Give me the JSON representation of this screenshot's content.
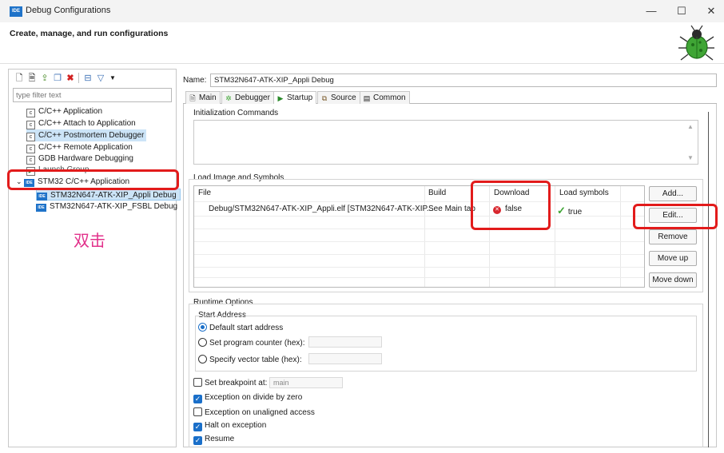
{
  "window": {
    "title": "Debug Configurations",
    "app_badge": "IDE",
    "minimize": "—",
    "maximize": "☐",
    "close": "✕"
  },
  "header": {
    "title": "Create, manage, and run configurations"
  },
  "left": {
    "toolbar_icons": [
      "new-config-icon",
      "new-prototype-icon",
      "export-icon",
      "duplicate-icon",
      "delete-icon",
      "collapse-all-icon",
      "filter-icon",
      "view-menu-icon"
    ],
    "filter_placeholder": "type filter text",
    "tree": [
      {
        "label": "C/C++ Application",
        "icon": "c-icon"
      },
      {
        "label": "C/C++ Attach to Application",
        "icon": "c-icon"
      },
      {
        "label": "C/C++ Postmortem Debugger",
        "icon": "c-icon"
      },
      {
        "label": "C/C++ Remote Application",
        "icon": "c-icon"
      },
      {
        "label": "GDB Hardware Debugging",
        "icon": "c-icon"
      },
      {
        "label": "Launch Group",
        "icon": "launch-group-icon"
      },
      {
        "label": "STM32 C/C++ Application",
        "icon": "ide-icon",
        "expanded": true
      },
      {
        "label": "STM32N647-ATK-XIP_Appli Debug",
        "icon": "ide-icon",
        "selected": true
      },
      {
        "label": "STM32N647-ATK-XIP_FSBL Debug",
        "icon": "ide-icon"
      }
    ],
    "annotation": "双击"
  },
  "main": {
    "name_label": "Name:",
    "name_value": "STM32N647-ATK-XIP_Appli Debug",
    "tabs": [
      {
        "label": "Main",
        "icon": "main-tab-icon"
      },
      {
        "label": "Debugger",
        "icon": "debugger-icon"
      },
      {
        "label": "Startup",
        "icon": "startup-icon",
        "active": true
      },
      {
        "label": "Source",
        "icon": "source-icon"
      },
      {
        "label": "Common",
        "icon": "common-icon"
      }
    ],
    "init_commands": {
      "title": "Initialization Commands",
      "value": ""
    },
    "load_image": {
      "title": "Load Image and Symbols",
      "columns": [
        "File",
        "Build",
        "Download",
        "Load symbols"
      ],
      "rows": [
        {
          "file": "Debug/STM32N647-ATK-XIP_Appli.elf [STM32N647-ATK-XIP...",
          "build": "See Main tab",
          "download": "false",
          "load_symbols": "true"
        }
      ],
      "buttons": [
        "Add...",
        "Edit...",
        "Remove",
        "Move up",
        "Move down"
      ]
    },
    "runtime": {
      "title": "Runtime Options",
      "start_address_title": "Start Address",
      "radios": [
        {
          "label": "Default start address",
          "checked": true
        },
        {
          "label": "Set program counter (hex):",
          "checked": false
        },
        {
          "label": "Specify vector table (hex):",
          "checked": false
        }
      ],
      "breakpoint": {
        "label": "Set breakpoint at:",
        "checked": false,
        "value": "main"
      },
      "checks": [
        {
          "label": "Exception on divide by zero",
          "checked": true
        },
        {
          "label": "Exception on unaligned access",
          "checked": false
        },
        {
          "label": "Halt on exception",
          "checked": true
        },
        {
          "label": "Resume",
          "checked": true
        }
      ]
    }
  },
  "colors": {
    "highlight_red": "#e21b1b",
    "selection_blue": "#cce4f7",
    "annotation_pink": "#e2318b",
    "checkbox_blue": "#1a6fc9"
  }
}
